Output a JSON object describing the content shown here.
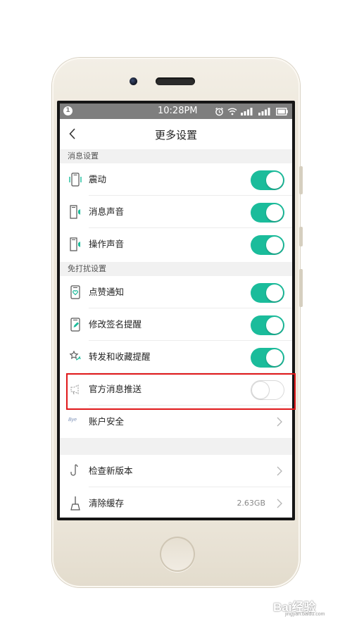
{
  "status_bar": {
    "notification_badge": "1",
    "time": "10:28PM",
    "icons": [
      "alarm-icon",
      "wifi-icon",
      "signal-icon",
      "signal-icon",
      "battery-icon"
    ]
  },
  "header": {
    "title": "更多设置",
    "back_icon": "chevron-left-icon"
  },
  "sections": [
    {
      "header": "消息设置",
      "items": [
        {
          "label": "震动",
          "icon": "phone-vibrate-icon",
          "control": "toggle",
          "enabled": true
        },
        {
          "label": "消息声音",
          "icon": "phone-sound-icon",
          "control": "toggle",
          "enabled": true
        },
        {
          "label": "操作声音",
          "icon": "phone-sound-icon",
          "control": "toggle",
          "enabled": true
        }
      ]
    },
    {
      "header": "免打扰设置",
      "items": [
        {
          "label": "点赞通知",
          "icon": "phone-heart-icon",
          "control": "toggle",
          "enabled": true
        },
        {
          "label": "修改签名提醒",
          "icon": "phone-pen-icon",
          "control": "toggle",
          "enabled": true
        },
        {
          "label": "转发和收藏提醒",
          "icon": "star-share-icon",
          "control": "toggle",
          "enabled": true
        },
        {
          "label": "官方消息推送",
          "icon": "megaphone-icon",
          "control": "toggle",
          "enabled": false
        },
        {
          "label": "账户安全",
          "icon": "bye-logo-icon",
          "icon_text": "Bye",
          "control": "chevron"
        }
      ]
    },
    {
      "items": [
        {
          "label": "检查新版本",
          "icon": "hook-icon",
          "control": "chevron"
        },
        {
          "label": "清除缓存",
          "icon": "broom-icon",
          "control": "chevron",
          "value": "2.63GB"
        }
      ]
    }
  ],
  "colors": {
    "toggle_on": "#1bbc9b",
    "highlight": "#e0181a",
    "status_bar": "#7e7e7e",
    "section_bg": "#f1f1f1"
  },
  "watermark": {
    "text": "Bai经验",
    "sub": "jingyan.baidu.com"
  }
}
